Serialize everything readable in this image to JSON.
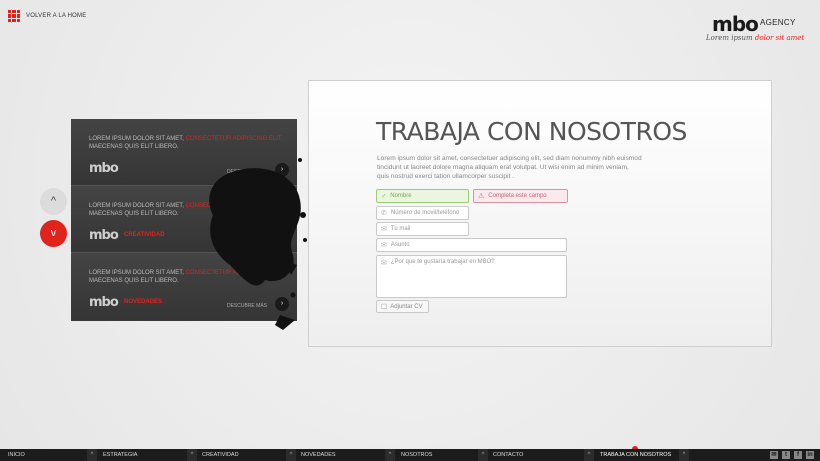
{
  "home": {
    "label": "VOLVER A LA HOME"
  },
  "brand": {
    "mark": "mbo",
    "agency": "AGENCY",
    "tag_plain": "Lorem ipsum ",
    "tag_red": "dolor sit amet"
  },
  "slides": [
    {
      "text_plain": "LOREM IPSUM DOLOR SIT AMET, ",
      "text_red": "CONSECTETUR ADIPISCING ELIT.",
      "text_rest": " MAECENAS QUIS ELIT LIBERO.",
      "logo": "mbo",
      "category": "",
      "more": "DESCUBRE MÁS"
    },
    {
      "text_plain": "LOREM IPSUM DOLOR SIT AMET, ",
      "text_red": "CONSECTETUR ADIPISCING ELIT.",
      "text_rest": " MAECENAS QUIS ELIT LIBERO.",
      "logo": "mbo",
      "category": "CREATIVIDAD",
      "more": "DESCUBRE MÁS"
    },
    {
      "text_plain": "LOREM IPSUM DOLOR SIT AMET, ",
      "text_red": "CONSECTETUR ADIPISCING ELIT.",
      "text_rest": " MAECENAS QUIS ELIT LIBERO.",
      "logo": "mbo",
      "category": "NOVEDADES",
      "more": "DESCUBRE MÁS"
    }
  ],
  "nav": {
    "up": "^",
    "down": "v"
  },
  "form": {
    "title": "TRABAJA CON NOSOTROS",
    "intro": "Lorem ipsum dolor sit amet, consectetuer adipiscing elit, sed diam nonummy nibh euismod tincidunt ut laoreet dolore magna aliquam erat volutpat. Ut wisi enim ad minim veniam, quis nostrud exerci tation ullamcorper suscipit .",
    "name_placeholder": "Nombre",
    "error_text": "Completa este campo",
    "phone_placeholder": "Número de movil/teléfono",
    "mail_placeholder": "Tu mail",
    "subject_placeholder": "Asunto",
    "message_placeholder": "¿Por que te gustaría trabajar en MBO?",
    "cv_label": "Adjuntar CV"
  },
  "footer": {
    "items": [
      "INICIO",
      "ESTRATEGIA",
      "CREATIVIDAD",
      "NOVEDADES",
      "NOSOTROS",
      "CONTACTO",
      "TRABAJA CON NOSOTROS"
    ],
    "active": "TRABAJA CON NOSOTROS",
    "social": [
      "mail-icon",
      "twitter-icon",
      "facebook-icon",
      "linkedin-icon"
    ]
  },
  "colors": {
    "accent": "#e0231d",
    "dark": "#1c1c1c",
    "valid": "#9ccc74",
    "error": "#d8939f"
  }
}
